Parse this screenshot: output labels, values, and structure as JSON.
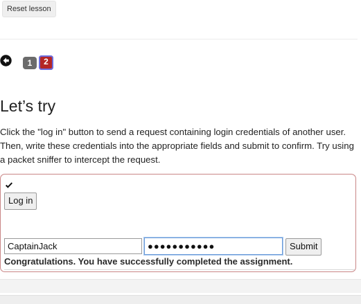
{
  "toolbar": {
    "reset_label": "Reset lesson"
  },
  "pagination": {
    "back_icon": "arrow-left-circle-icon",
    "pages": [
      "1",
      "2"
    ],
    "current_page": "2"
  },
  "lesson": {
    "title": "Let’s try",
    "description": "Click the \"log in\" button to send a request containing login credentials of another user. Then, write these credentials into the appropriate fields and submit to confirm. Try using a packet sniffer to intercept the request."
  },
  "assignment": {
    "status_icon": "check-icon",
    "login_label": "Log in",
    "username_value": "CaptainJack",
    "password_value": "●●●●●●●●●●●",
    "submit_label": "Submit",
    "result_text": "Congratulations. You have successfully completed the assignment."
  },
  "colors": {
    "current_page": "#b42626",
    "page": "#6b6b6b",
    "panel_border": "#c98585",
    "focus": "#6b9bd8"
  }
}
